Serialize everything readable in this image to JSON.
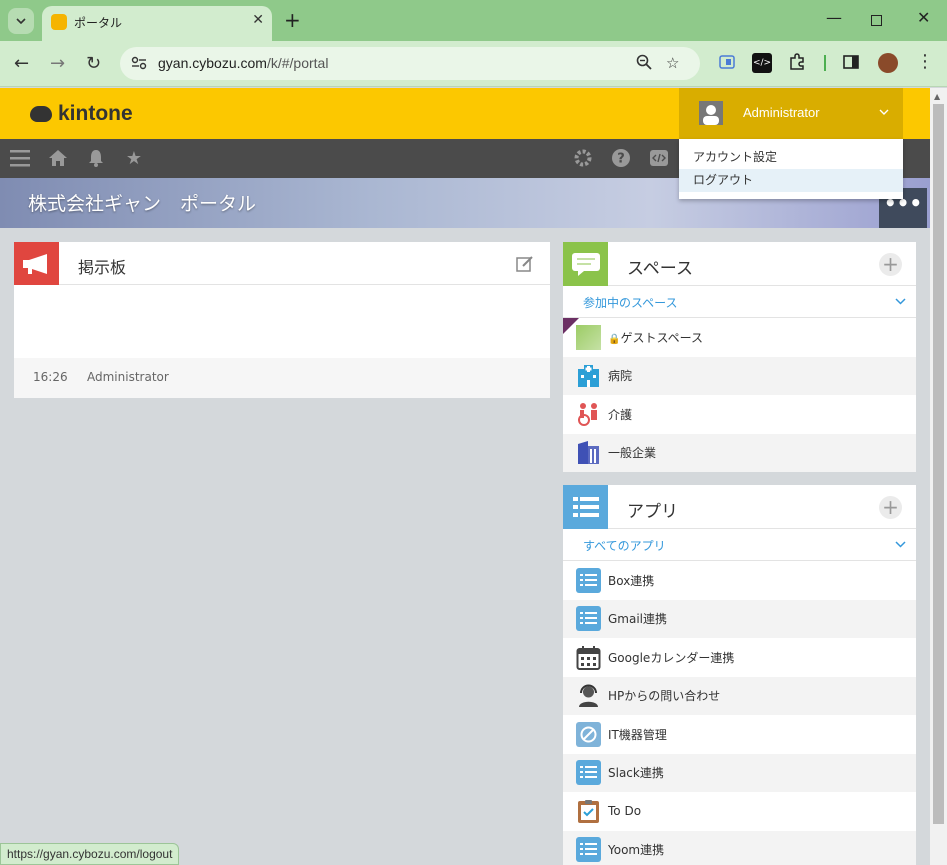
{
  "browser": {
    "tab_title": "ポータル",
    "url_host": "gyan.cybozu.com",
    "url_path": "/k/#/portal",
    "status_url": "https://gyan.cybozu.com/logout"
  },
  "header": {
    "logo": "kintone",
    "user_name": "Administrator"
  },
  "user_menu": {
    "items": [
      "アカウント設定",
      "ログアウト"
    ]
  },
  "banner": {
    "title": "株式会社ギャン　ポータル"
  },
  "bulletin": {
    "title": "掲示板",
    "time": "16:26",
    "author": "Administrator"
  },
  "spaces": {
    "title": "スペース",
    "filter": "参加中のスペース",
    "items": [
      {
        "label": "ゲストスペース",
        "icon": "guest-space-icon"
      },
      {
        "label": "病院",
        "icon": "hospital-icon"
      },
      {
        "label": "介護",
        "icon": "care-icon"
      },
      {
        "label": "一般企業",
        "icon": "company-icon"
      }
    ]
  },
  "apps": {
    "title": "アプリ",
    "filter": "すべてのアプリ",
    "items": [
      {
        "label": "Box連携",
        "icon": "list-app-icon"
      },
      {
        "label": "Gmail連携",
        "icon": "list-app-icon"
      },
      {
        "label": "Googleカレンダー連携",
        "icon": "calendar-icon"
      },
      {
        "label": "HPからの問い合わせ",
        "icon": "support-icon"
      },
      {
        "label": "IT機器管理",
        "icon": "it-device-icon"
      },
      {
        "label": "Slack連携",
        "icon": "list-app-icon"
      },
      {
        "label": "To Do",
        "icon": "todo-icon"
      },
      {
        "label": "Yoom連携",
        "icon": "list-app-icon"
      }
    ]
  },
  "colors": {
    "header": "#fcc800",
    "accent_blue": "#3498db",
    "bulletin_icon": "#e0463f"
  }
}
